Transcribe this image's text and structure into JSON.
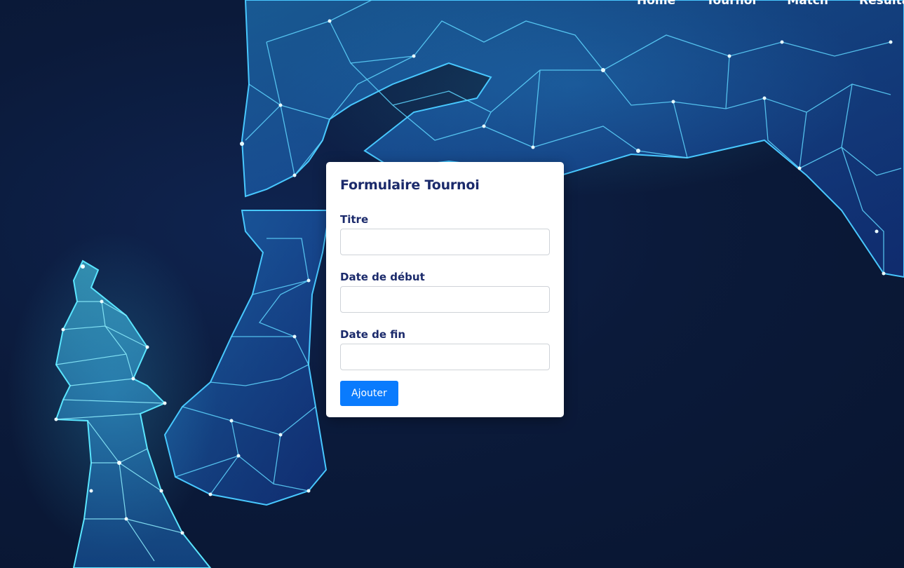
{
  "nav": {
    "items": [
      {
        "label": "Home"
      },
      {
        "label": "Tournoi"
      },
      {
        "label": "Match"
      },
      {
        "label": "Résultats"
      }
    ]
  },
  "form": {
    "title": "Formulaire Tournoi",
    "fields": [
      {
        "label": "Titre",
        "value": "",
        "placeholder": ""
      },
      {
        "label": "Date de début",
        "value": "",
        "placeholder": ""
      },
      {
        "label": "Date de fin",
        "value": "",
        "placeholder": ""
      }
    ],
    "submit_label": "Ajouter"
  },
  "colors": {
    "background": "#0b1a3a",
    "accent": "#0a7bfd",
    "title_text": "#1b2a6b",
    "art_glow": "#3fd0ff"
  },
  "background_art": {
    "icons": [
      "chess-knight-icon",
      "chess-bishop-icon"
    ]
  }
}
